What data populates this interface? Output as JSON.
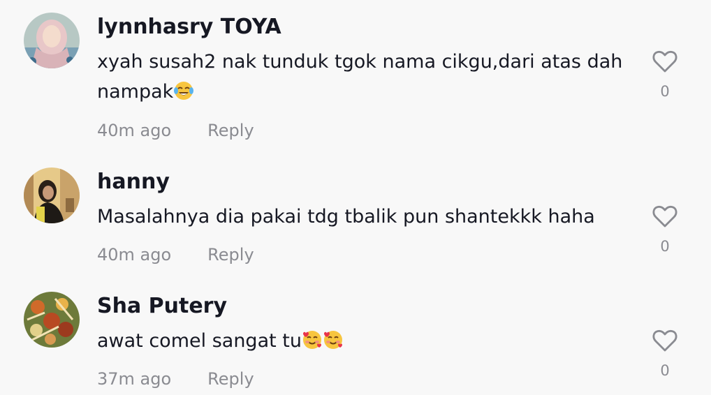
{
  "comments": [
    {
      "username": "lynnhasry TOYA",
      "text": "xyah susah2 nak tunduk tgok nama cikgu,dari atas dah nampak",
      "emojis": [
        "face-with-tears-of-joy"
      ],
      "time": "40m ago",
      "reply_label": "Reply",
      "likes": "0"
    },
    {
      "username": "hanny",
      "text": "Masalahnya dia pakai tdg tbalik pun shantekkk haha",
      "emojis": [],
      "time": "40m ago",
      "reply_label": "Reply",
      "likes": "0"
    },
    {
      "username": "Sha Putery",
      "text": "awat comel sangat tu",
      "emojis": [
        "smiling-face-with-hearts",
        "smiling-face-with-hearts"
      ],
      "time": "37m ago",
      "reply_label": "Reply",
      "likes": "0"
    }
  ],
  "icons": {
    "like": "heart-outline-icon",
    "laugh_emoji": "face-with-tears-of-joy",
    "hearts_emoji": "smiling-face-with-hearts"
  },
  "colors": {
    "background": "#f8f8f8",
    "text_primary": "#161823",
    "text_secondary": "#8a8b91"
  }
}
